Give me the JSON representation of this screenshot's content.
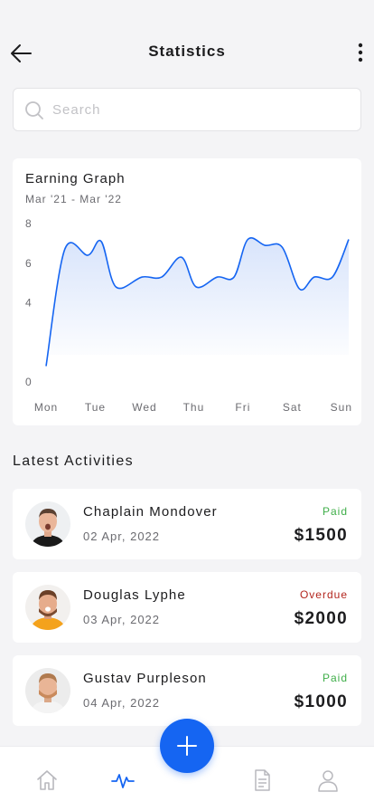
{
  "header": {
    "title": "Statistics",
    "back_icon": "arrow-left-icon",
    "more_icon": "more-vertical-icon"
  },
  "search": {
    "placeholder": "Search",
    "value": "",
    "icon": "search-icon"
  },
  "earning_graph": {
    "title": "Earning Graph",
    "range": "Mar '21 - Mar '22"
  },
  "chart_data": {
    "type": "area",
    "title": "Earning Graph",
    "subtitle": "Mar '21 - Mar '22",
    "categories": [
      "Mon",
      "Tue",
      "Wed",
      "Thu",
      "Fri",
      "Sat",
      "Sun"
    ],
    "ylim": [
      0,
      8
    ],
    "yticks": [
      "0",
      "4",
      "6",
      "8"
    ],
    "grid": false,
    "series": [
      {
        "x": [
          0,
          0.38,
          0.85,
          1.12,
          1.42,
          1.95,
          2.35,
          2.75,
          3.05,
          3.48,
          3.82,
          4.1,
          4.45,
          4.8,
          5.15,
          5.45,
          5.82,
          6.15
        ],
        "values": [
          0.8,
          6.7,
          6.4,
          7.1,
          4.8,
          5.3,
          5.3,
          6.3,
          4.8,
          5.3,
          5.3,
          7.2,
          6.9,
          6.8,
          4.7,
          5.3,
          5.3,
          7.2
        ]
      }
    ],
    "colors": {
      "line": "#1565f2",
      "fill_top": "#d8e4fb",
      "fill_bottom": "#ffffff"
    }
  },
  "activities": {
    "title": "Latest Activities",
    "items": [
      {
        "name": "Chaplain Mondover",
        "date": "02 Apr, 2022",
        "status": "Paid",
        "status_color": "#3fae49",
        "amount": "$1500"
      },
      {
        "name": "Douglas Lyphe",
        "date": "03 Apr, 2022",
        "status": "Overdue",
        "status_color": "#b3261e",
        "amount": "$2000"
      },
      {
        "name": "Gustav Purpleson",
        "date": "04 Apr, 2022",
        "status": "Paid",
        "status_color": "#3fae49",
        "amount": "$1000"
      }
    ]
  },
  "bottom_nav": {
    "items": [
      {
        "icon": "home-icon",
        "active": false
      },
      {
        "icon": "activity-pulse-icon",
        "active": true
      },
      {
        "icon": "document-icon",
        "active": false
      },
      {
        "icon": "user-icon",
        "active": false
      }
    ],
    "fab_icon": "plus-icon",
    "active_color": "#1565f2",
    "inactive_color": "#b8b8bd"
  }
}
